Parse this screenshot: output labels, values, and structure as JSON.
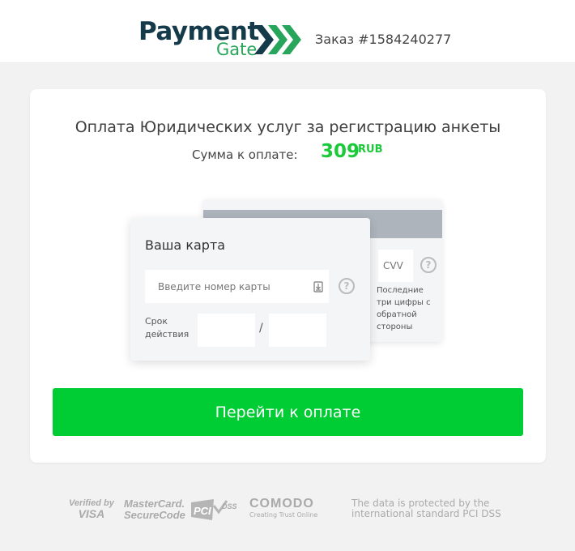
{
  "header": {
    "logo_main": "Payment",
    "logo_sub": "Gate",
    "order_label": "Заказ #1584240277"
  },
  "payment": {
    "title": "Оплата Юридических услуг за регистрацию анкеты",
    "sum_label": "Сумма к оплате:",
    "amount": "309",
    "currency": "RUB"
  },
  "card_form": {
    "front_title": "Ваша карта",
    "card_number_placeholder": "Введите номер карты",
    "help_symbol": "?",
    "expiry_label_line1": "Срок",
    "expiry_label_line2": "действия",
    "expiry_separator": "/",
    "cvv_placeholder": "CVV",
    "cvv_note": "Последние три цифры с обратной стороны"
  },
  "actions": {
    "pay_button": "Перейти к оплате"
  },
  "footer": {
    "verified_line1": "Verified by",
    "verified_line2": "VISA",
    "mastercard_line1": "MasterCard.",
    "mastercard_line2": "SecureCode",
    "pci_label": "PCI DSS",
    "comodo_label": "COMODO",
    "comodo_sub": "Creating Trust Online",
    "security_note": "The data is protected by the international standard PCI DSS"
  },
  "colors": {
    "brand_dark": "#153a4a",
    "brand_green": "#27a55a",
    "amount_green": "#1bc93a",
    "button_green": "#00cc33"
  }
}
